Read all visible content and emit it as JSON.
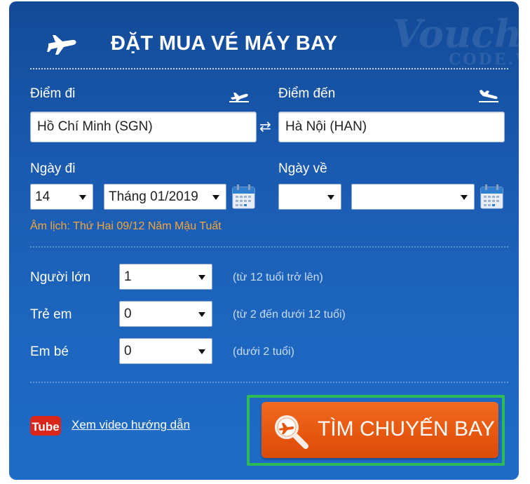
{
  "header": {
    "title": "ĐẶT MUA VÉ MÁY BAY",
    "icon": "airplane-icon",
    "watermark": {
      "line1": "Voucher",
      "line2": "CODE.VN"
    }
  },
  "route": {
    "from_label": "Điểm đi",
    "from_icon": "takeoff-icon",
    "from_value": "Hồ Chí Minh (SGN)",
    "swap_icon": "⇄",
    "to_label": "Điểm đến",
    "to_icon": "landing-icon",
    "to_value": "Hà Nội (HAN)"
  },
  "dates": {
    "depart_label": "Ngày đi",
    "depart_day": "14",
    "depart_month": "Tháng 01/2019",
    "return_label": "Ngày về",
    "return_day": "",
    "return_month": "",
    "calendar_icon": "calendar-icon",
    "lunar": "Âm lịch: Thứ Hai 09/12 Năm Mậu Tuất"
  },
  "passengers": [
    {
      "label": "Người lớn",
      "value": "1",
      "hint": "(từ 12 tuổi trở lên)"
    },
    {
      "label": "Trẻ em",
      "value": "0",
      "hint": "(từ 2 đến dưới 12 tuổi)"
    },
    {
      "label": "Em bé",
      "value": "0",
      "hint": "(dưới 2 tuổi)"
    }
  ],
  "footer": {
    "youtube_logo": "Tube",
    "video_link": "Xem video hướng dẫn",
    "search_button": "TÌM CHUYẾN BAY",
    "search_icon": "magnifier-plane-icon"
  },
  "colors": {
    "panel": "#1a5bb0",
    "lunar_text": "#f7a537",
    "button": "#e6560f",
    "highlight_frame": "#2dbb55"
  }
}
